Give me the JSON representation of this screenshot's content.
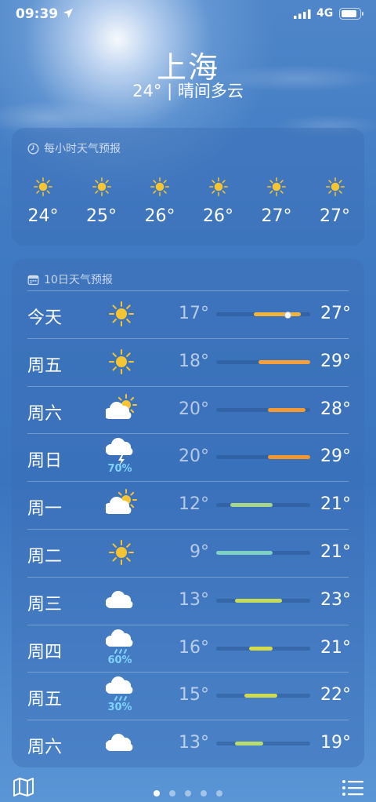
{
  "status": {
    "time": "09:39",
    "network": "4G"
  },
  "location": {
    "city": "上海",
    "summary": "24° | 晴间多云"
  },
  "hourly": {
    "header": "每小时天气预报",
    "items": [
      {
        "temp": "24°",
        "icon": "sun-icon"
      },
      {
        "temp": "25°",
        "icon": "sun-icon"
      },
      {
        "temp": "26°",
        "icon": "sun-icon"
      },
      {
        "temp": "26°",
        "icon": "sun-icon"
      },
      {
        "temp": "27°",
        "icon": "sun-icon"
      },
      {
        "temp": "27°",
        "icon": "sun-icon"
      }
    ]
  },
  "daily": {
    "header": "10日天气预报",
    "range": [
      9,
      29
    ],
    "days": [
      {
        "name": "今天",
        "icon": "sun-icon",
        "precip": "",
        "low": "17°",
        "high": "27°",
        "lo": 17,
        "hi": 27,
        "current": 24,
        "color": "#f0b43a"
      },
      {
        "name": "周五",
        "icon": "sun-icon",
        "precip": "",
        "low": "18°",
        "high": "29°",
        "lo": 18,
        "hi": 29,
        "color": "#f3a03a"
      },
      {
        "name": "周六",
        "icon": "partly-cloudy-icon",
        "precip": "",
        "low": "20°",
        "high": "28°",
        "lo": 20,
        "hi": 28,
        "color": "#f39a32"
      },
      {
        "name": "周日",
        "icon": "thunderstorm-icon",
        "precip": "70%",
        "low": "20°",
        "high": "29°",
        "lo": 20,
        "hi": 29,
        "color": "#f2962f"
      },
      {
        "name": "周一",
        "icon": "partly-cloudy-icon",
        "precip": "",
        "low": "12°",
        "high": "21°",
        "lo": 12,
        "hi": 21,
        "color": "#a8d68a"
      },
      {
        "name": "周二",
        "icon": "sun-icon",
        "precip": "",
        "low": "9°",
        "high": "21°",
        "lo": 9,
        "hi": 21,
        "color": "#7dd0c2"
      },
      {
        "name": "周三",
        "icon": "cloud-icon",
        "precip": "",
        "low": "13°",
        "high": "23°",
        "lo": 13,
        "hi": 23,
        "color": "#c5dc5a"
      },
      {
        "name": "周四",
        "icon": "rain-icon",
        "precip": "60%",
        "low": "16°",
        "high": "21°",
        "lo": 16,
        "hi": 21,
        "color": "#d4dc4a"
      },
      {
        "name": "周五",
        "icon": "rain-icon",
        "precip": "30%",
        "low": "15°",
        "high": "22°",
        "lo": 15,
        "hi": 22,
        "color": "#d0dc50"
      },
      {
        "name": "周六",
        "icon": "cloud-icon",
        "precip": "",
        "low": "13°",
        "high": "19°",
        "lo": 13,
        "hi": 19,
        "color": "#b8dc70"
      }
    ]
  },
  "pager": {
    "pages": 5,
    "active": 0
  }
}
